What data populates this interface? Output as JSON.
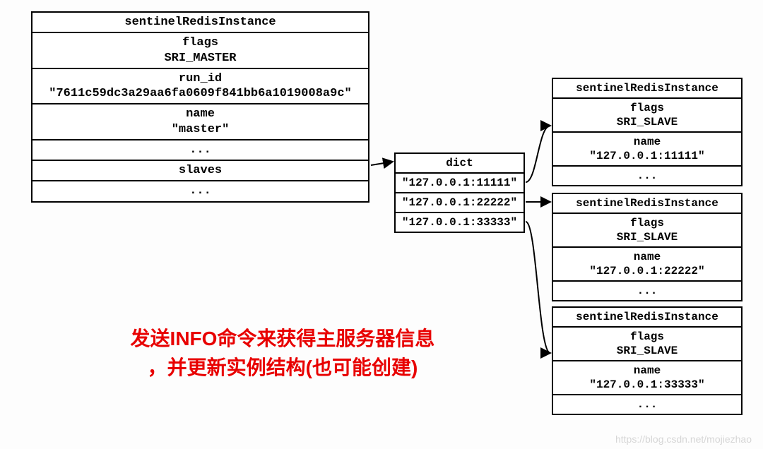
{
  "master": {
    "title": "sentinelRedisInstance",
    "flags_label": "flags",
    "flags_value": "SRI_MASTER",
    "runid_label": "run_id",
    "runid_value": "\"7611c59dc3a29aa6fa0609f841bb6a1019008a9c\"",
    "name_label": "name",
    "name_value": "\"master\"",
    "ellipsis1": "...",
    "slaves_label": "slaves",
    "ellipsis2": "..."
  },
  "dict": {
    "title": "dict",
    "k1": "\"127.0.0.1:11111\"",
    "k2": "\"127.0.0.1:22222\"",
    "k3": "\"127.0.0.1:33333\""
  },
  "slave1": {
    "title": "sentinelRedisInstance",
    "flags_label": "flags",
    "flags_value": "SRI_SLAVE",
    "name_label": "name",
    "name_value": "\"127.0.0.1:11111\"",
    "ellipsis": "..."
  },
  "slave2": {
    "title": "sentinelRedisInstance",
    "flags_label": "flags",
    "flags_value": "SRI_SLAVE",
    "name_label": "name",
    "name_value": "\"127.0.0.1:22222\"",
    "ellipsis": "..."
  },
  "slave3": {
    "title": "sentinelRedisInstance",
    "flags_label": "flags",
    "flags_value": "SRI_SLAVE",
    "name_label": "name",
    "name_value": "\"127.0.0.1:33333\"",
    "ellipsis": "..."
  },
  "caption": {
    "line1": "发送INFO命令来获得主服务器信息",
    "line2": "，并更新实例结构(也可能创建)"
  },
  "watermark": "https://blog.csdn.net/mojiezhao"
}
